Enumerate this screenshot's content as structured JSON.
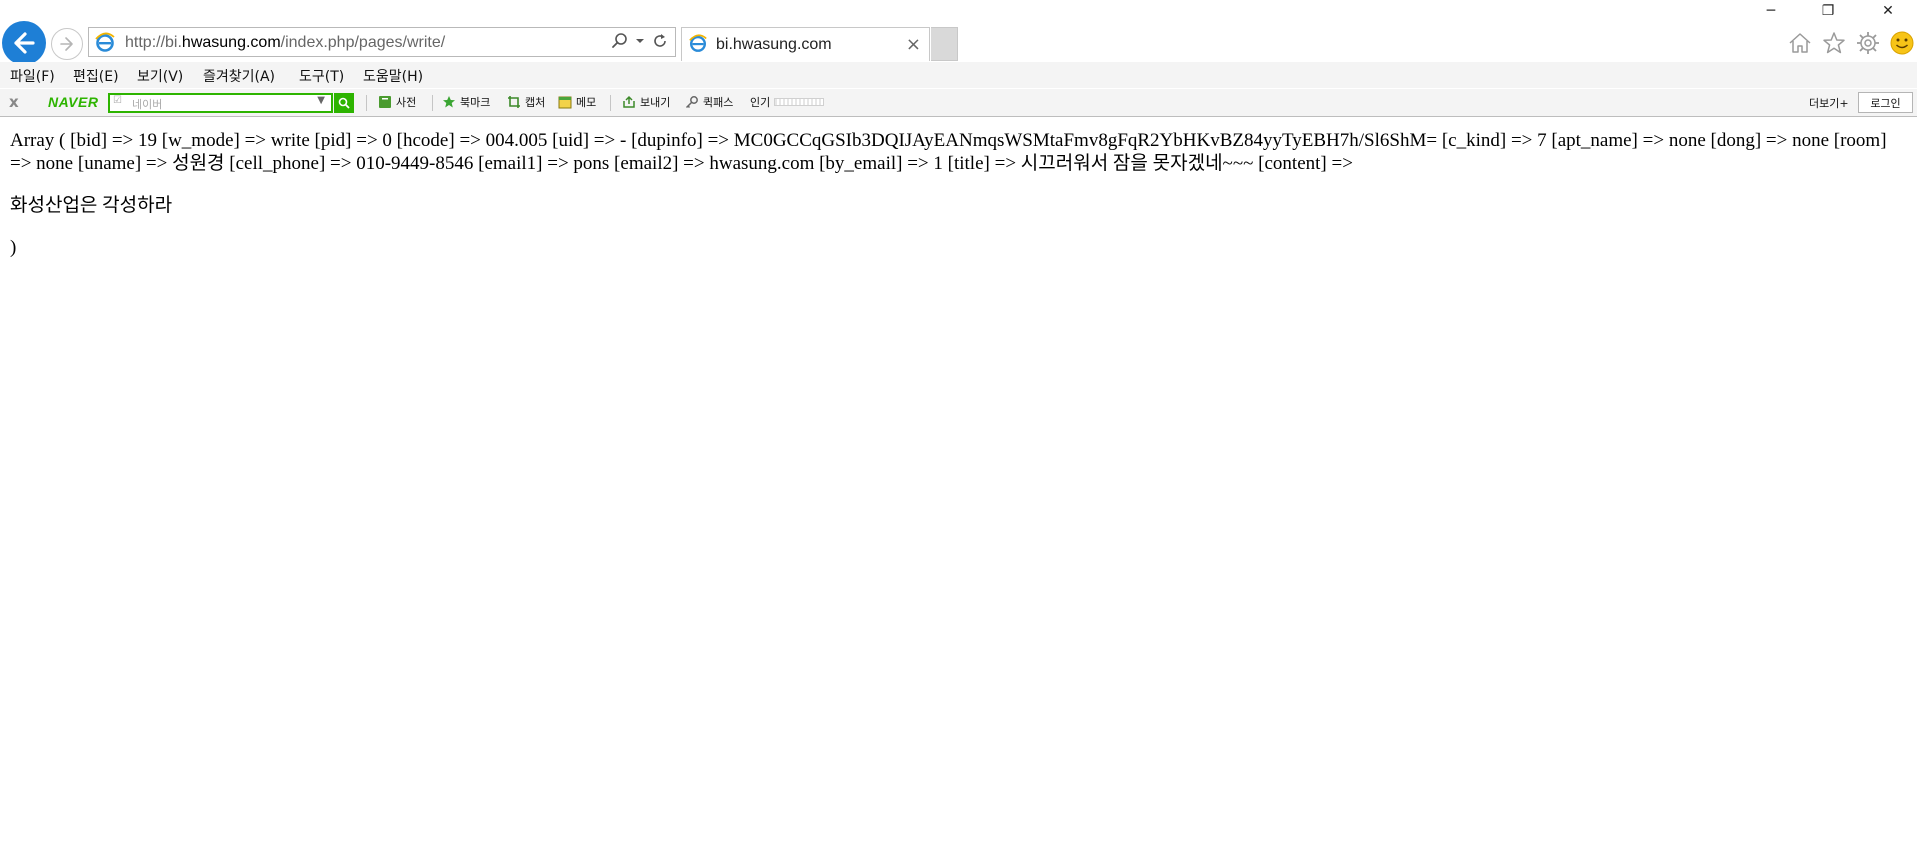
{
  "window": {
    "minimize": "─",
    "restore": "❐",
    "close": "✕"
  },
  "address_bar": {
    "url_prefix": "http://bi.",
    "url_domain": "hwasung.com",
    "url_path": "/index.php/pages/write/"
  },
  "tab": {
    "title": "bi.hwasung.com",
    "close": "×"
  },
  "menu": {
    "file": "파일(F)",
    "edit": "편집(E)",
    "view": "보기(V)",
    "favorites": "즐겨찾기(A)",
    "tools": "도구(T)",
    "help": "도움말(H)"
  },
  "naver_toolbar": {
    "close": "x",
    "brand": "NAVER",
    "search_placeholder": "네이버",
    "dictionary": "사전",
    "bookmark": "북마크",
    "capture": "캡처",
    "memo": "메모",
    "send": "보내기",
    "quickpass": "퀵패스",
    "popular": "인기",
    "more": "더보기",
    "login": "로그인"
  },
  "content": {
    "array_dump": "Array ( [bid] => 19 [w_mode] => write [pid] => 0 [hcode] => 004.005 [uid] => - [dupinfo] => MC0GCCqGSIb3DQIJAyEANmqsWSMtaFmv8gFqR2YbHKvBZ84yyTyEBH7h/Sl6ShM= [c_kind] => 7 [apt_name] => none [dong] => none [room] => none [uname] => 성원경 [cell_phone] => 010-9449-8546 [email1] => pons [email2] => hwasung.com [by_email] => 1 [title] => 시끄러워서 잠을 못자겠네~~~ [content] =>",
    "content_text": "화성산업은 각성하라",
    "closing": ")"
  },
  "colors": {
    "accent_blue": "#1e7fd6",
    "naver_green": "#2db400"
  }
}
